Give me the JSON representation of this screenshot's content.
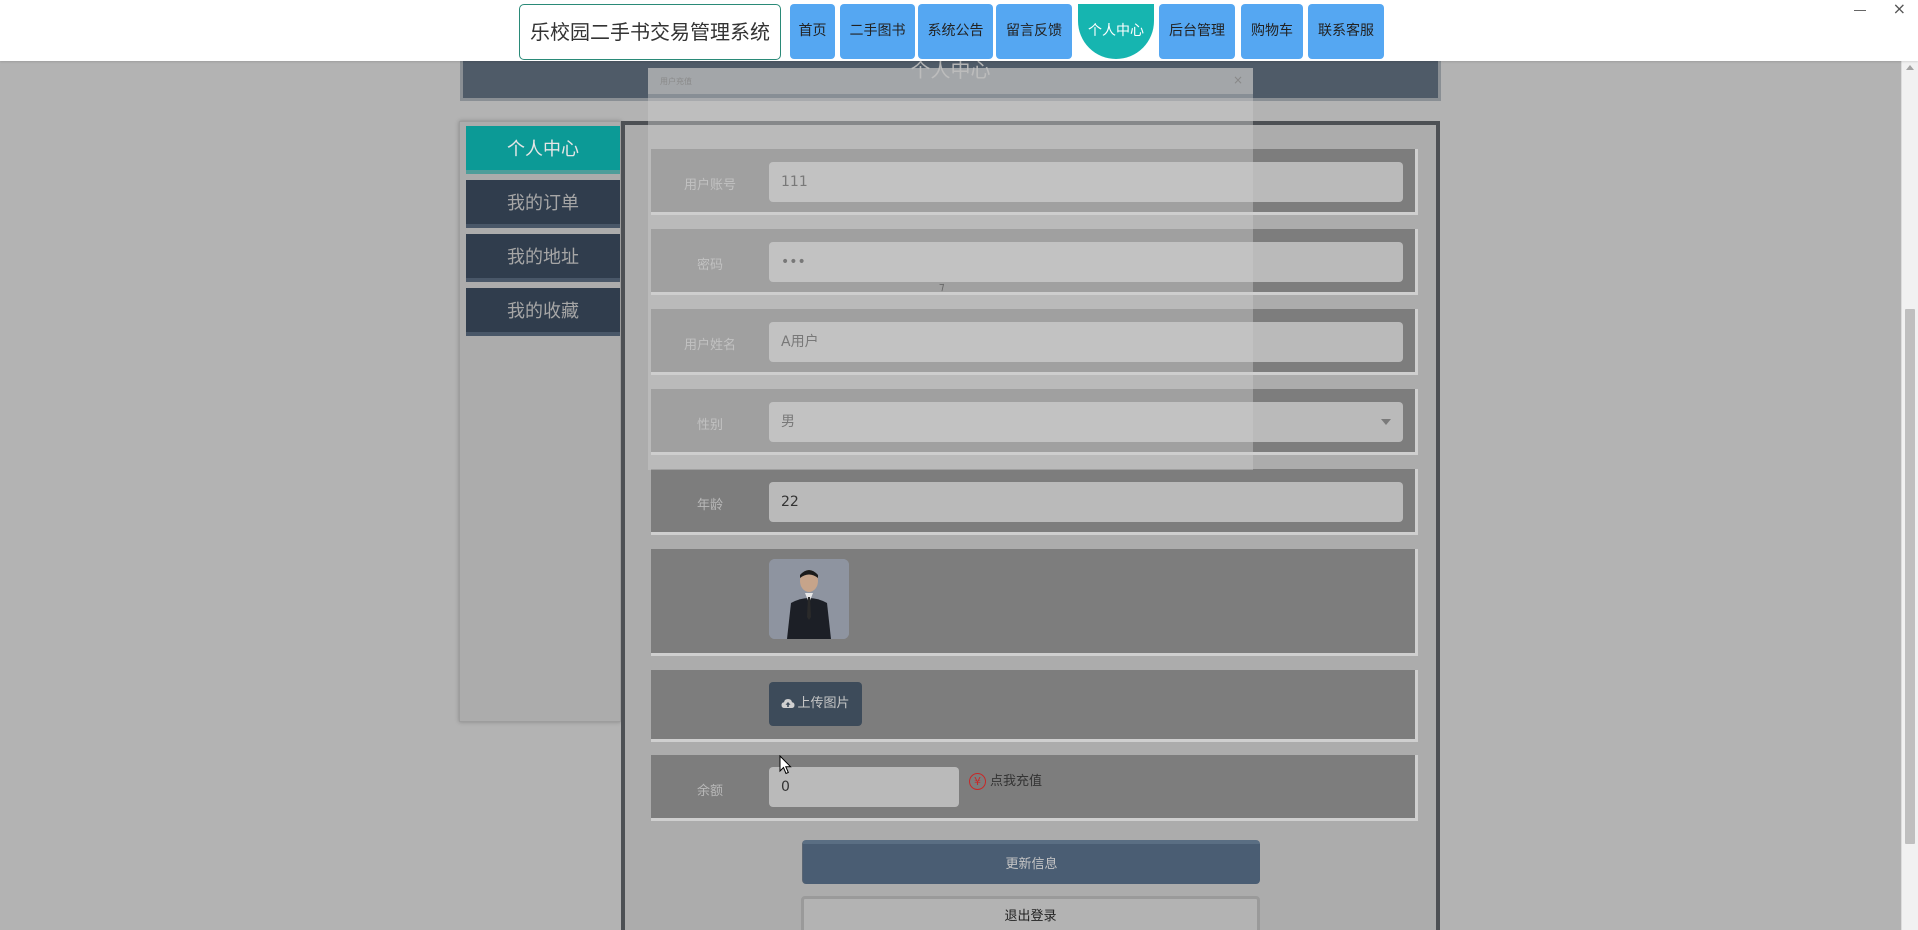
{
  "topnav": {
    "brand": "乐校园二手书交易管理系统",
    "items": [
      {
        "label": "首页"
      },
      {
        "label": "二手图书"
      },
      {
        "label": "系统公告"
      },
      {
        "label": "留言反馈"
      },
      {
        "label": "个人中心"
      },
      {
        "label": "后台管理"
      },
      {
        "label": "购物车"
      },
      {
        "label": "联系客服"
      }
    ],
    "active_item": "个人中心",
    "close_glyph": "×"
  },
  "page_header": {
    "title": "个人中心"
  },
  "sidebar": {
    "items": [
      {
        "label": "个人中心"
      },
      {
        "label": "我的订单"
      },
      {
        "label": "我的地址"
      },
      {
        "label": "我的收藏"
      }
    ],
    "active_item": "个人中心"
  },
  "form": {
    "account": {
      "label": "用户账号",
      "value": "111"
    },
    "password": {
      "label": "密码",
      "value": "•••"
    },
    "name": {
      "label": "用户姓名",
      "value": "A用户"
    },
    "gender": {
      "label": "性别",
      "value": "男"
    },
    "age": {
      "label": "年龄",
      "value": "22"
    },
    "upload_label": "上传图片",
    "balance": {
      "label": "余额",
      "value": "0",
      "recharge_label": "点我充值",
      "currency_glyph": "¥"
    }
  },
  "actions": {
    "update_label": "更新信息",
    "logout_label": "退出登录"
  },
  "modal": {
    "title": "用户充值",
    "close_glyph": "×",
    "loading_glyph": "⁊"
  },
  "colors": {
    "nav_button": "#55a7f2",
    "nav_active": "#16b5b0",
    "sidebar_active": "#0c9a96",
    "sidebar_item": "#303d4d",
    "recharge_icon": "#c82828"
  }
}
